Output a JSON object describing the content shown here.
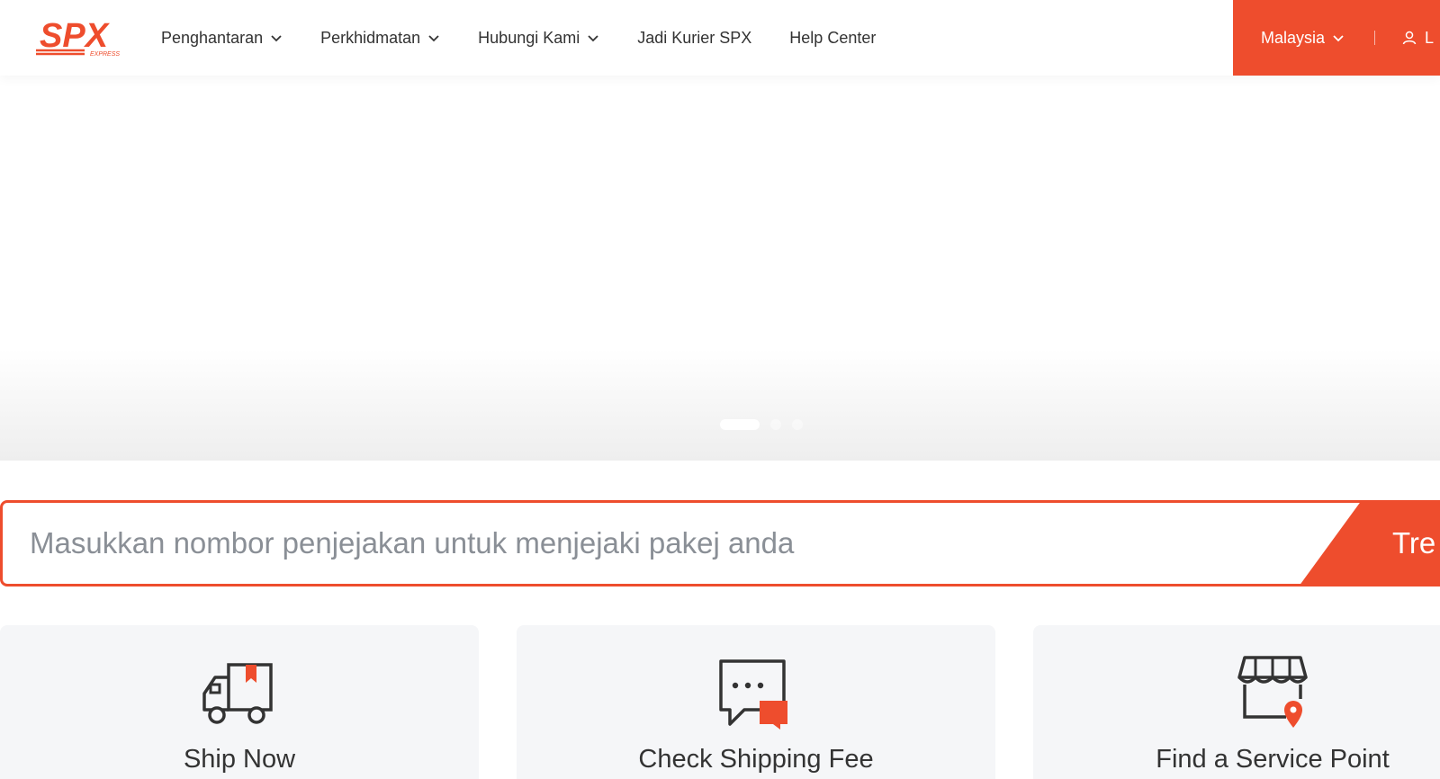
{
  "header": {
    "logo_text": "SPX",
    "logo_subtext": "EXPRESS",
    "nav": [
      {
        "label": "Penghantaran",
        "has_dropdown": true
      },
      {
        "label": "Perkhidmatan",
        "has_dropdown": true
      },
      {
        "label": "Hubungi Kami",
        "has_dropdown": true
      },
      {
        "label": "Jadi Kurier SPX",
        "has_dropdown": false
      },
      {
        "label": "Help Center",
        "has_dropdown": false
      }
    ],
    "country": "Malaysia",
    "login": "L"
  },
  "banner": {
    "slides": 3,
    "active_slide": 1
  },
  "tracking": {
    "placeholder": "Masukkan nombor penjejakan untuk menjejaki pakej anda",
    "button_label": "Trek"
  },
  "services": [
    {
      "label": "Ship Now",
      "icon": "delivery-truck-icon"
    },
    {
      "label": "Check Shipping Fee",
      "icon": "chat-bubble-icon"
    },
    {
      "label": "Find a Service Point",
      "icon": "store-location-icon"
    }
  ],
  "colors": {
    "accent": "#ee4d2d",
    "text": "#333333",
    "card_bg": "#f5f6f8"
  }
}
